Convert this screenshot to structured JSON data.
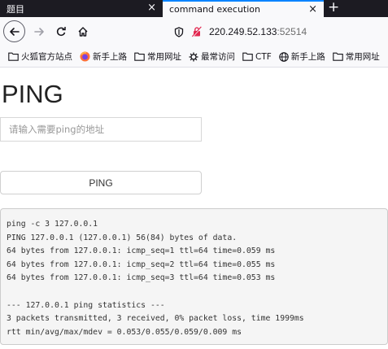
{
  "tabs": [
    {
      "label": "题目",
      "active": false
    },
    {
      "label": "command execution",
      "active": true
    }
  ],
  "new_tab_glyph": "+",
  "close_glyph": "×",
  "url": {
    "host": "220.249.52.133",
    "port": ":52514"
  },
  "bookmarks": [
    {
      "label": "火狐官方站点",
      "icon": "folder-icon"
    },
    {
      "label": "新手上路",
      "icon": "firefox-icon"
    },
    {
      "label": "常用网址",
      "icon": "folder-icon"
    },
    {
      "label": "最常访问",
      "icon": "gear-icon"
    },
    {
      "label": "CTF",
      "icon": "folder-icon"
    },
    {
      "label": "新手上路",
      "icon": "globe-icon"
    },
    {
      "label": "常用网址",
      "icon": "folder-icon"
    }
  ],
  "page": {
    "title": "PING",
    "input_placeholder": "请输入需要ping的地址",
    "button_label": "PING"
  },
  "output_lines": [
    "ping -c 3 127.0.0.1",
    "PING 127.0.0.1 (127.0.0.1) 56(84) bytes of data.",
    "64 bytes from 127.0.0.1: icmp_seq=1 ttl=64 time=0.059 ms",
    "64 bytes from 127.0.0.1: icmp_seq=2 ttl=64 time=0.055 ms",
    "64 bytes from 127.0.0.1: icmp_seq=3 ttl=64 time=0.053 ms",
    "",
    "--- 127.0.0.1 ping statistics ---",
    "3 packets transmitted, 3 received, 0% packet loss, time 1999ms",
    "rtt min/avg/max/mdev = 0.053/0.055/0.059/0.009 ms"
  ],
  "colors": {
    "tabbar": "#1c1b22",
    "accent": "#0a84ff",
    "insecure": "#e22850"
  }
}
